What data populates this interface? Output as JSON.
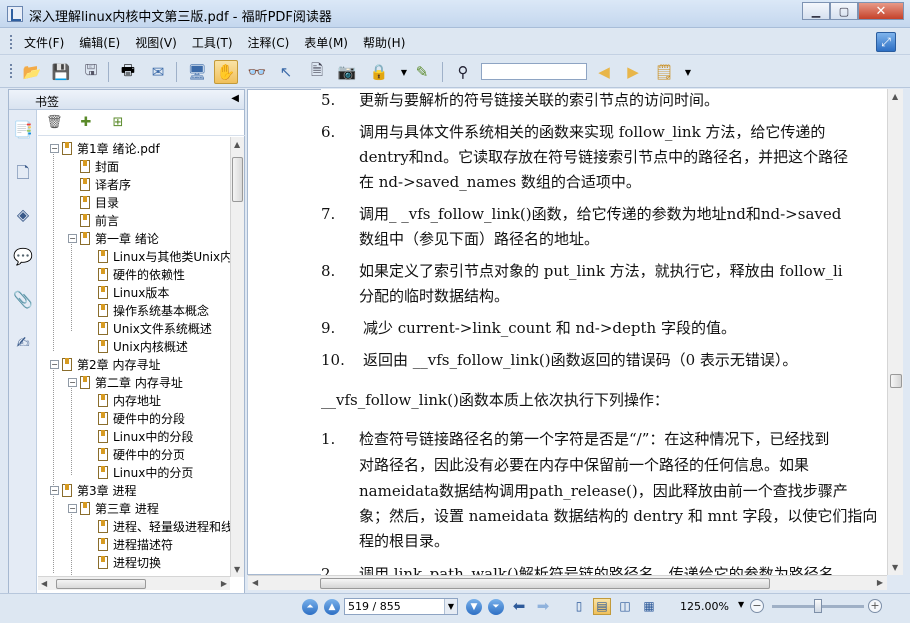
{
  "window": {
    "title": "深入理解linux内核中文第三版.pdf - 福昕PDF阅读器"
  },
  "menu": [
    "文件(F)",
    "编辑(E)",
    "视图(V)",
    "工具(T)",
    "注释(C)",
    "表单(M)",
    "帮助(H)"
  ],
  "toolbar": {
    "search_value": ""
  },
  "bookmarks": {
    "header": "书签",
    "items": [
      {
        "label": "第1章 绪论.pdf",
        "level": 0,
        "expanded": true
      },
      {
        "label": "封面",
        "level": 1
      },
      {
        "label": "译者序",
        "level": 1
      },
      {
        "label": "目录",
        "level": 1
      },
      {
        "label": "前言",
        "level": 1
      },
      {
        "label": "第一章 绪论",
        "level": 1,
        "expanded": true
      },
      {
        "label": "Linux与其他类Unix内",
        "level": 2
      },
      {
        "label": "硬件的依赖性",
        "level": 2
      },
      {
        "label": "Linux版本",
        "level": 2
      },
      {
        "label": "操作系统基本概念",
        "level": 2
      },
      {
        "label": "Unix文件系统概述",
        "level": 2
      },
      {
        "label": "Unix内核概述",
        "level": 2
      },
      {
        "label": "第2章 内存寻址",
        "level": 0,
        "expanded": true
      },
      {
        "label": "第二章 内存寻址",
        "level": 1,
        "expanded": true
      },
      {
        "label": "内存地址",
        "level": 2
      },
      {
        "label": "硬件中的分段",
        "level": 2
      },
      {
        "label": "Linux中的分段",
        "level": 2
      },
      {
        "label": "硬件中的分页",
        "level": 2
      },
      {
        "label": "Linux中的分页",
        "level": 2
      },
      {
        "label": "第3章 进程",
        "level": 0,
        "expanded": true
      },
      {
        "label": "第三章 进程",
        "level": 1,
        "expanded": true
      },
      {
        "label": "进程、轻量级进程和线",
        "level": 2
      },
      {
        "label": "进程描述符",
        "level": 2
      },
      {
        "label": "进程切换",
        "level": 2
      }
    ]
  },
  "document": {
    "lines": [
      {
        "num": "5.",
        "text": "更新与要解析的符号链接关联的索引节点的访问时间。"
      },
      {
        "num": "6.",
        "text": "调用与具体文件系统相关的函数来实现 follow_link 方法，给它传递的"
      },
      {
        "num": "",
        "text": "dentry和nd。它读取存放在符号链接索引节点中的路径名，并把这个路径"
      },
      {
        "num": "",
        "text": "在 nd->saved_names 数组的合适项中。"
      },
      {
        "num": "7.",
        "text": "调用_ _vfs_follow_link()函数，给它传递的参数为地址nd和nd->saved"
      },
      {
        "num": "",
        "text": "数组中（参见下面）路径名的地址。"
      },
      {
        "num": "8.",
        "text": "如果定义了索引节点对象的 put_link 方法，就执行它，释放由 follow_li"
      },
      {
        "num": "",
        "text": "分配的临时数据结构。"
      },
      {
        "num": "9.",
        "text": "减少 current->link_count 和 nd->depth 字段的值。"
      },
      {
        "num": "10.",
        "text": "返回由 __vfs_follow_link()函数返回的错误码（0 表示无错误）。"
      },
      {
        "num": "",
        "text": "__vfs_follow_link()函数本质上依次执行下列操作："
      },
      {
        "num": "1.",
        "text": "检查符号链接路径名的第一个字符是否是“/”：在这种情况下，已经找到"
      },
      {
        "num": "",
        "text": "对路径名，因此没有必要在内存中保留前一个路径的任何信息。如果"
      },
      {
        "num": "",
        "text": "nameidata数据结构调用path_release()，因此释放由前一个查找步骤产"
      },
      {
        "num": "",
        "text": "象；然后，设置 nameidata 数据结构的 dentry 和 mnt 字段，以使它们指向"
      },
      {
        "num": "",
        "text": "程的根目录。"
      },
      {
        "num": "2.",
        "text": "调用 link_path_walk()解析符号链的路径名，传递给它的参数为路径名"
      }
    ]
  },
  "statusbar": {
    "page_display": "519 / 855",
    "zoom": "125.00%"
  }
}
